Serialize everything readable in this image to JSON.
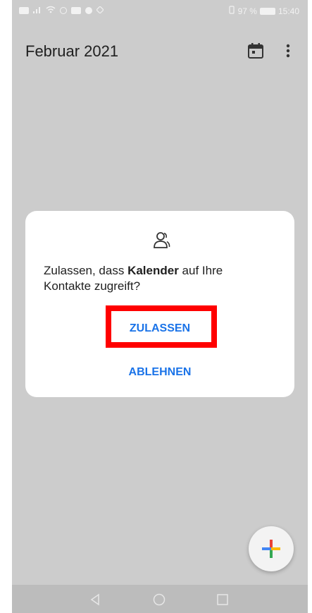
{
  "status_bar": {
    "battery_text": "97 %",
    "time": "15:40"
  },
  "app_bar": {
    "title": "Februar 2021",
    "today_icon": "calendar-today-icon",
    "more_icon": "more-vert-icon"
  },
  "dialog": {
    "icon": "contacts-icon",
    "message_prefix": "Zulassen, dass ",
    "app_name": "Kalender",
    "message_suffix": " auf Ihre Kontakte zugreift?",
    "allow_label": "ZULASSEN",
    "deny_label": "ABLEHNEN"
  },
  "fab": {
    "icon": "add-icon"
  },
  "nav_bar": {
    "back_icon": "nav-back-icon",
    "home_icon": "nav-home-icon",
    "recent_icon": "nav-recents-icon"
  },
  "colors": {
    "accent": "#1a73e8",
    "scrim": "#cccccc",
    "highlight": "#ff0000"
  }
}
